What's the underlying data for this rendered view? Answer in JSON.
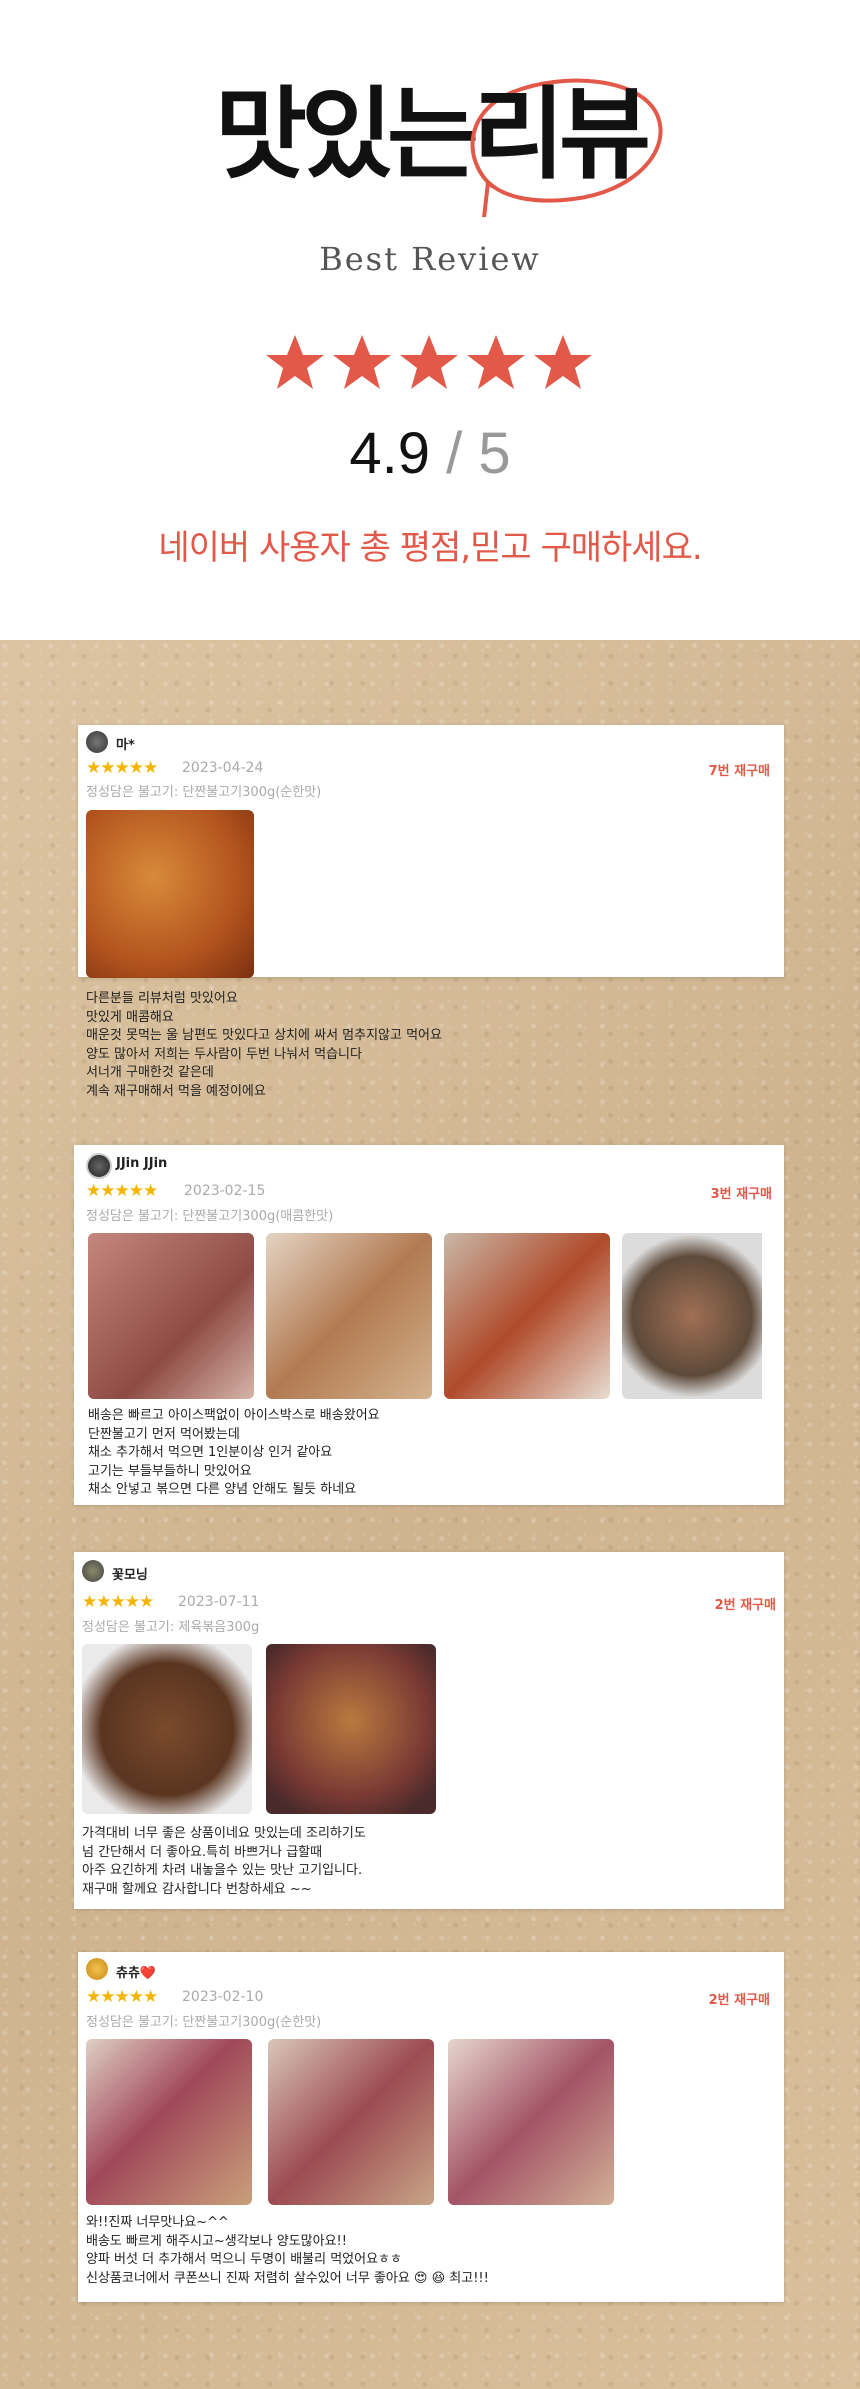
{
  "header": {
    "title_part1": "맛있는",
    "title_accent": "리뷰",
    "subtitle": "Best Review",
    "stars": "★★★★★",
    "score": "4.9",
    "score_sep": " / ",
    "score_max": "5",
    "tagline": "네이버 사용자 총 평점,믿고 구매하세요."
  },
  "colors": {
    "accent": "#e2594a",
    "star": "#f4b400",
    "paper": "#d6bd9a"
  },
  "reviews": [
    {
      "user": "마*",
      "stars": "★★★★★",
      "date": "2023-04-24",
      "option": "정성담은 불고기: 단짠불고기300g(순한맛)",
      "repurchase": "7번 재구매",
      "text": "다른분들 리뷰처럼 맛있어요\n맛있게 매콤해요\n매운것 못먹는 울 남편도 맛있다고 상치에 싸서 멈추지않고 먹어요\n양도 많아서 저희는 두사람이 두번 나눠서 먹습니다\n서너개 구매한것 같은데\n계속 재구매해서 먹을 예정이에요"
    },
    {
      "user": "JJin JJin",
      "stars": "★★★★★",
      "date": "2023-02-15",
      "option": "정성담은 불고기: 단짠불고기300g(매콤한맛)",
      "repurchase": "3번 재구매",
      "text": "배송은 빠르고 아이스팩없이 아이스박스로 배송왔어요\n단짠불고기 먼저 먹어봤는데\n채소 추가해서 먹으면 1인분이상 인거 같아요\n고기는 부들부들하니 맛있어요\n채소 안넣고 볶으면 다른 양념 안해도 될듯 하네요"
    },
    {
      "user": "꽃모닝",
      "stars": "★★★★★",
      "date": "2023-07-11",
      "option": "정성담은 불고기: 제육볶음300g",
      "repurchase": "2번 재구매",
      "text": "가격대비 너무 좋은 상품이네요 맛있는데 조리하기도\n넘 간단해서 더 좋아요.특히 바쁘거나 급할때\n아주 요긴하게 차려 내놓을수 있는 맛난 고기입니다.\n재구매 할께요 감사합니다 번창하세요 ~~"
    },
    {
      "user": "츄츄❤️",
      "stars": "★★★★★",
      "date": "2023-02-10",
      "option": "정성담은 불고기: 단짠불고기300g(순한맛)",
      "repurchase": "2번 재구매",
      "text": "와!!진짜 너무맛나요~^^\n배송도 빠르게 해주시고~생각보나 양도많아요!!\n양파 버섯 더 추가해서 먹으니 두명이 배불리 먹었어요ㅎㅎ\n신상품코너에서 쿠폰쓰니 진짜 저렴히 살수있어 너무 좋아요 😍 😆 최고!!!"
    }
  ]
}
